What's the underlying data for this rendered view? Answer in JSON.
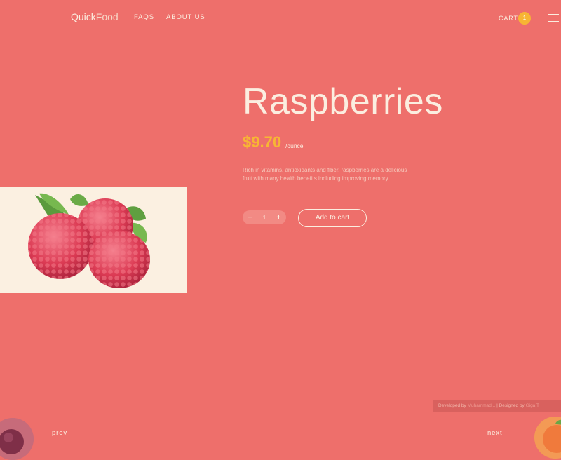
{
  "header": {
    "logo_bold": "Quick",
    "logo_rest": "Food",
    "nav": [
      "FAQS",
      "ABOUT US"
    ],
    "cart_label": "CART",
    "cart_count": "1"
  },
  "product": {
    "name": "Raspberries",
    "price": "$9.70",
    "unit": "/ounce",
    "description": "Rich in vitamins, antioxidants and fiber, raspberries are a delicious fruit with many health benefits including improving memory.",
    "quantity": "1",
    "minus": "−",
    "plus": "+",
    "add_to_cart": "Add to cart"
  },
  "credit": {
    "dev_prefix": "Developed by",
    "dev_name": "Muhammad...",
    "sep": " | Designed by",
    "designer": "Giga T"
  },
  "pager": {
    "prev": "prev",
    "next": "next"
  },
  "colors": {
    "background": "#ee6f6b",
    "accent": "#f7b534",
    "text": "#fbeee0",
    "panel": "#fbf0e1"
  },
  "icons": {
    "menu": "hamburger-menu-icon",
    "product_image": "raspberries-image"
  }
}
